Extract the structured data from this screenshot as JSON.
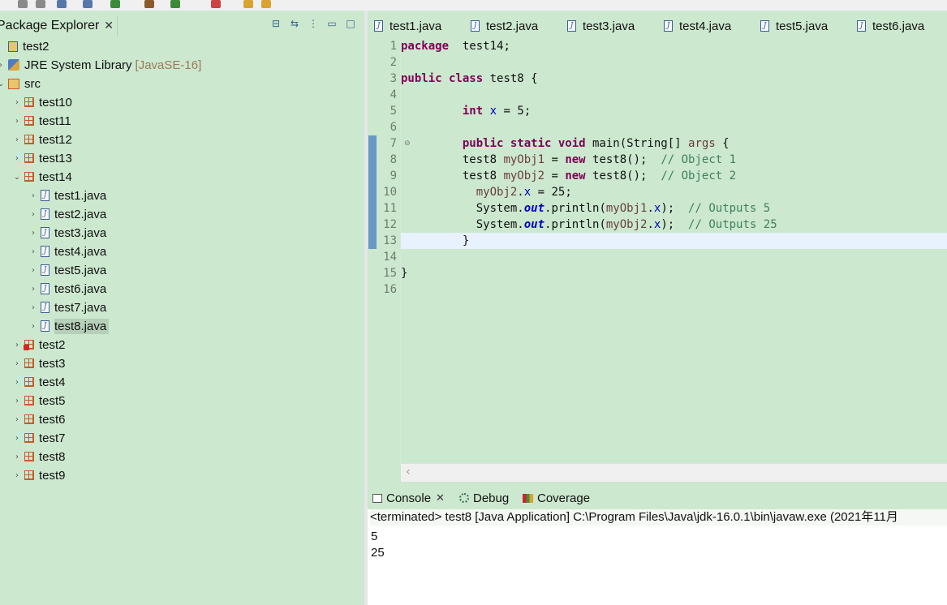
{
  "toolbar": {
    "icons": [
      "save-icon",
      "save-all-icon",
      "print-icon",
      "search-icon",
      "run-icon",
      "debug-icon",
      "coverage-icon",
      "new-java-icon",
      "nav-back-icon",
      "nav-forward-icon"
    ]
  },
  "explorer": {
    "title": "Package Explorer",
    "close": "✕",
    "tree": [
      {
        "label": "test2",
        "icon": "project",
        "twisty": "",
        "indent": 0
      },
      {
        "label": "JRE System Library",
        "extra": "[JavaSE-16]",
        "icon": "lib",
        "twisty": "›",
        "indent": 0
      },
      {
        "label": "src",
        "icon": "src",
        "twisty": "⌄",
        "indent": 0
      },
      {
        "label": "test10",
        "icon": "pkg",
        "twisty": "›",
        "indent": 1
      },
      {
        "label": "test11",
        "icon": "pkg",
        "twisty": "›",
        "indent": 1
      },
      {
        "label": "test12",
        "icon": "pkg",
        "twisty": "›",
        "indent": 1
      },
      {
        "label": "test13",
        "icon": "pkg",
        "twisty": "›",
        "indent": 1
      },
      {
        "label": "test14",
        "icon": "pkg",
        "twisty": "⌄",
        "indent": 1
      },
      {
        "label": "test1.java",
        "icon": "java",
        "twisty": "›",
        "indent": 2
      },
      {
        "label": "test2.java",
        "icon": "java",
        "twisty": "›",
        "indent": 2
      },
      {
        "label": "test3.java",
        "icon": "java",
        "twisty": "›",
        "indent": 2
      },
      {
        "label": "test4.java",
        "icon": "java",
        "twisty": "›",
        "indent": 2
      },
      {
        "label": "test5.java",
        "icon": "java",
        "twisty": "›",
        "indent": 2
      },
      {
        "label": "test6.java",
        "icon": "java",
        "twisty": "›",
        "indent": 2
      },
      {
        "label": "test7.java",
        "icon": "java",
        "twisty": "›",
        "indent": 2
      },
      {
        "label": "test8.java",
        "icon": "java",
        "twisty": "›",
        "indent": 2,
        "selected": true
      },
      {
        "label": "test2",
        "icon": "pkg-err",
        "twisty": "›",
        "indent": 1
      },
      {
        "label": "test3",
        "icon": "pkg",
        "twisty": "›",
        "indent": 1
      },
      {
        "label": "test4",
        "icon": "pkg",
        "twisty": "›",
        "indent": 1
      },
      {
        "label": "test5",
        "icon": "pkg",
        "twisty": "›",
        "indent": 1
      },
      {
        "label": "test6",
        "icon": "pkg",
        "twisty": "›",
        "indent": 1
      },
      {
        "label": "test7",
        "icon": "pkg",
        "twisty": "›",
        "indent": 1
      },
      {
        "label": "test8",
        "icon": "pkg",
        "twisty": "›",
        "indent": 1
      },
      {
        "label": "test9",
        "icon": "pkg",
        "twisty": "›",
        "indent": 1
      }
    ]
  },
  "editor": {
    "tabs": [
      "test1.java",
      "test2.java",
      "test3.java",
      "test4.java",
      "test5.java",
      "test6.java"
    ],
    "line_numbers": [
      "1",
      "2",
      "3",
      "4",
      "5",
      "6",
      "7",
      "8",
      "9",
      "10",
      "11",
      "12",
      "13",
      "14",
      "15",
      "16"
    ],
    "current_line": 13,
    "lines": [
      [
        [
          "kw",
          "package"
        ],
        [
          "",
          "  test14;"
        ]
      ],
      [],
      [
        [
          "kw",
          "public class"
        ],
        [
          "",
          " test8 {"
        ]
      ],
      [],
      [
        [
          "",
          "         "
        ],
        [
          "kw",
          "int"
        ],
        [
          "",
          " "
        ],
        [
          "fld",
          "x"
        ],
        [
          "",
          " = 5;"
        ]
      ],
      [],
      [
        [
          "",
          "         "
        ],
        [
          "kw",
          "public static void"
        ],
        [
          "",
          " main(String[] "
        ],
        [
          "var",
          "args"
        ],
        [
          "",
          " {"
        ]
      ],
      [
        [
          "",
          "         test8 "
        ],
        [
          "var",
          "myObj1"
        ],
        [
          "",
          " = "
        ],
        [
          "kw",
          "new"
        ],
        [
          "",
          " test8();  "
        ],
        [
          "cmt",
          "// Object 1"
        ]
      ],
      [
        [
          "",
          "         test8 "
        ],
        [
          "var",
          "myObj2"
        ],
        [
          "",
          " = "
        ],
        [
          "kw",
          "new"
        ],
        [
          "",
          " test8();  "
        ],
        [
          "cmt",
          "// Object 2"
        ]
      ],
      [
        [
          "",
          "           "
        ],
        [
          "var",
          "myObj2"
        ],
        [
          "",
          "."
        ],
        [
          "fld",
          "x"
        ],
        [
          "",
          " = 25;"
        ]
      ],
      [
        [
          "",
          "           System."
        ],
        [
          "sfld",
          "out"
        ],
        [
          "",
          ".println("
        ],
        [
          "var",
          "myObj1"
        ],
        [
          "",
          "."
        ],
        [
          "fld",
          "x"
        ],
        [
          "",
          ");  "
        ],
        [
          "cmt",
          "// Outputs 5"
        ]
      ],
      [
        [
          "",
          "           System."
        ],
        [
          "sfld",
          "out"
        ],
        [
          "",
          ".println("
        ],
        [
          "var",
          "myObj2"
        ],
        [
          "",
          "."
        ],
        [
          "fld",
          "x"
        ],
        [
          "",
          ");  "
        ],
        [
          "cmt",
          "// Outputs 25"
        ]
      ],
      [
        [
          "",
          "         }"
        ]
      ],
      [],
      [
        [
          "",
          "}"
        ]
      ],
      []
    ]
  },
  "console": {
    "tabs": [
      {
        "label": "Console",
        "icon": "console",
        "close": true
      },
      {
        "label": "Debug",
        "icon": "debug"
      },
      {
        "label": "Coverage",
        "icon": "coverage"
      }
    ],
    "terminated": "<terminated> test8 [Java Application] C:\\Program Files\\Java\\jdk-16.0.1\\bin\\javaw.exe  (2021年11月",
    "output": [
      "5",
      "25"
    ]
  }
}
